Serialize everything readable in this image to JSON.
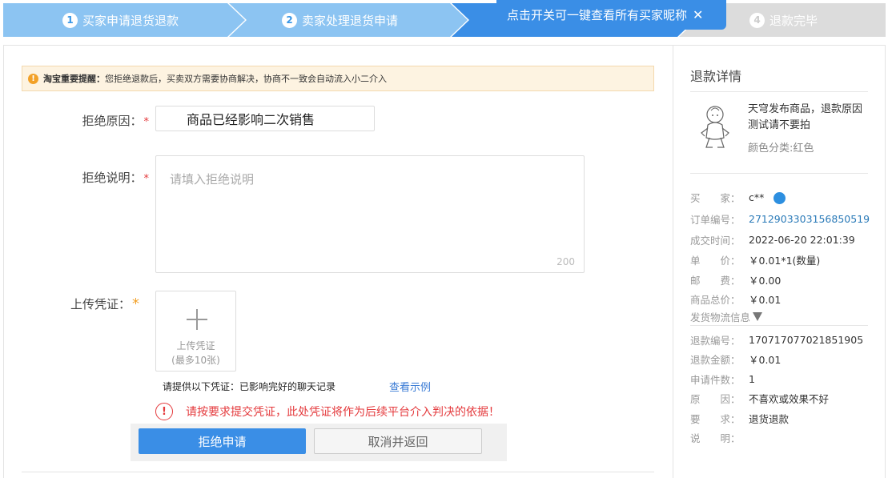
{
  "steps": [
    {
      "num": "1",
      "label": "买家申请退货退款"
    },
    {
      "num": "2",
      "label": "卖家处理退货申请"
    },
    {
      "num": "4",
      "label": "退款完毕"
    }
  ],
  "tooltip": {
    "text": "点击开关可一键查看所有买家昵称",
    "close": "✕"
  },
  "warning": {
    "icon": "!",
    "bold": "淘宝重要提醒：",
    "text": "您拒绝退款后，买卖双方需要协商解决，协商不一致会自动流入小二介入"
  },
  "form": {
    "reason_label": "拒绝原因：",
    "reason_value": "商品已经影响二次销售",
    "desc_label": "拒绝说明：",
    "desc_placeholder": "请填入拒绝说明",
    "desc_count": "200",
    "upload_label": "上传凭证：",
    "upload_text": "上传凭证",
    "upload_limit": "(最多10张)",
    "required_mark": "*",
    "tip": "请提供以下凭证：已影响完好的聊天记录",
    "example_link": "查看示例",
    "error_icon": "!",
    "error_msg": "请按要求提交凭证，此处凭证将作为后续平台介入判决的依据！",
    "reject_btn": "拒绝申请",
    "cancel_btn": "取消并返回"
  },
  "panel": {
    "title": "退款详情",
    "product_name": "天穹发布商品，退款原因测试请不要拍",
    "product_sku": "颜色分类:红色",
    "info": [
      {
        "k": "买　　家：",
        "v": "c**"
      },
      {
        "k": "订单编号：",
        "v": "2712903303156850519"
      },
      {
        "k": "成交时间：",
        "v": "2022-06-20 22:01:39"
      },
      {
        "k": "单　　价：",
        "v": "￥0.01*1(数量)"
      },
      {
        "k": "邮　　费：",
        "v": "￥0.00"
      },
      {
        "k": "商品总价：",
        "v": "￥0.01"
      }
    ],
    "logistics": "发货物流信息",
    "refund": [
      {
        "k": "退款编号：",
        "v": "170717077021851905"
      },
      {
        "k": "退款金额：",
        "v": "￥0.01"
      },
      {
        "k": "申请件数：",
        "v": "1"
      },
      {
        "k": "原　　因：",
        "v": "不喜欢或效果不好"
      },
      {
        "k": "要　　求：",
        "v": "退货退款"
      },
      {
        "k": "说　　明：",
        "v": ""
      }
    ]
  },
  "colors": {
    "accent": "#3a8ee6",
    "error": "#e4393c",
    "warning": "#f2a128"
  }
}
